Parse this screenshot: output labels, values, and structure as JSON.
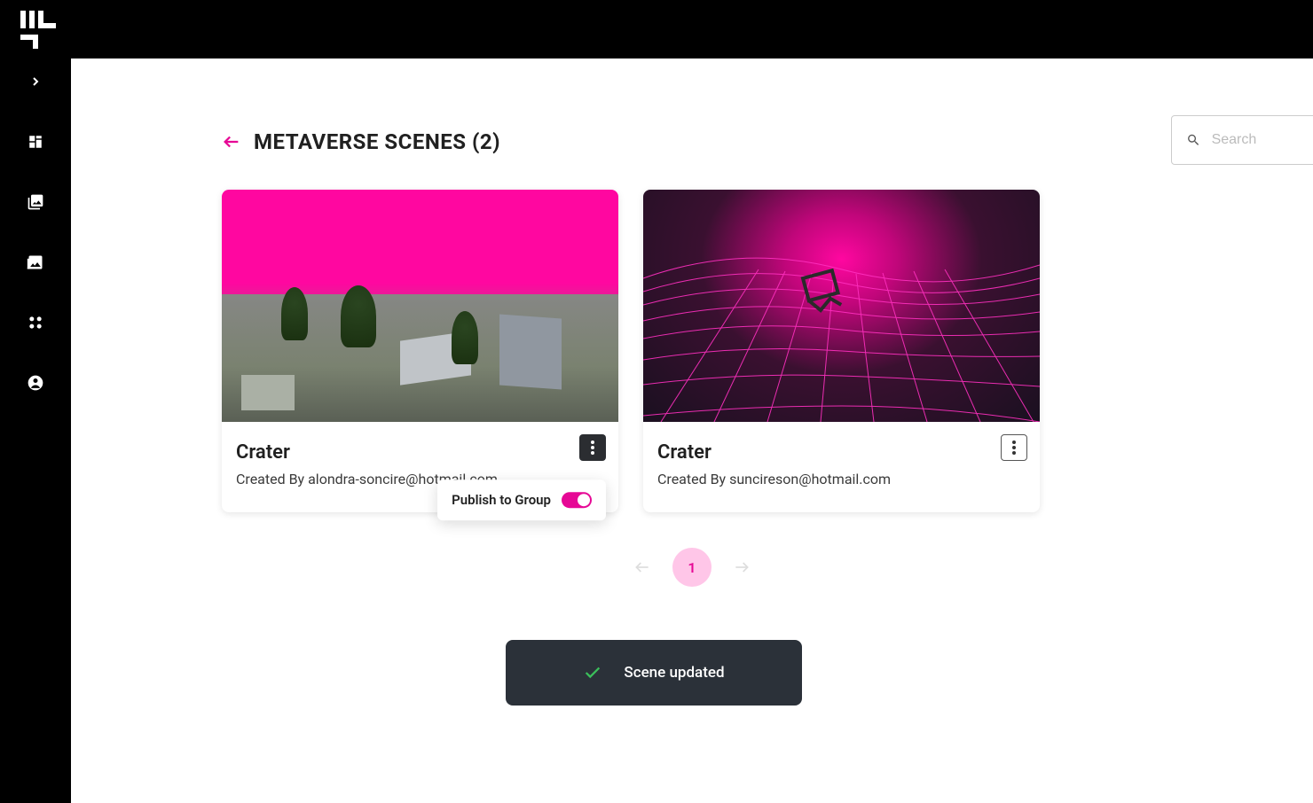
{
  "page_title": "METAVERSE SCENES (2)",
  "search": {
    "placeholder": "Search"
  },
  "popover": {
    "label": "Publish to Group"
  },
  "cards": [
    {
      "title": "Crater",
      "subtitle": "Created By alondra-soncire@hotmail.com"
    },
    {
      "title": "Crater",
      "subtitle": "Created By suncireson@hotmail.com"
    }
  ],
  "pagination": {
    "current": "1"
  },
  "toast": {
    "message": "Scene updated"
  },
  "sidebar_icons": [
    "collapse",
    "dashboard",
    "layers",
    "images",
    "dots",
    "account"
  ],
  "colors": {
    "accent": "#e60895"
  }
}
